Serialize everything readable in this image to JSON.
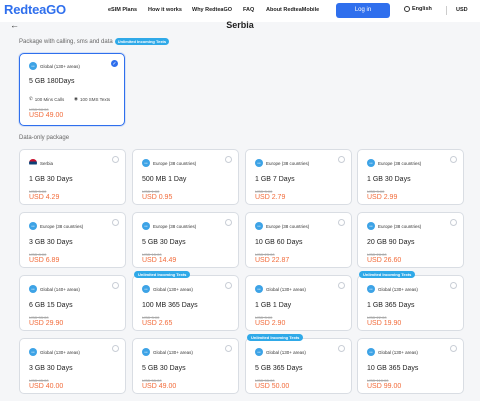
{
  "nav": {
    "logo": "RedteaGO",
    "items": [
      "eSIM Plans",
      "How it works",
      "Why RedteaGO",
      "FAQ",
      "About RedteaMobile"
    ],
    "login": "Log in",
    "language": "English",
    "currency": "USD"
  },
  "page": {
    "back": "←",
    "title": "Serbia"
  },
  "calling_section": {
    "label": "Package with calling, sms and data",
    "pill": "Unlimited Incoming Texts",
    "card": {
      "region": "Global (130+ areas)",
      "plan": "5 GB  180Days",
      "mins": "100 Mins Calls",
      "sms": "100 SMS Texts",
      "old_price": "USD 58.00",
      "price": "USD 49.00",
      "selected": true
    }
  },
  "data_section": {
    "label": "Data-only package",
    "cards": [
      {
        "region": "Serbia",
        "flag": true,
        "plan": "1 GB  30 Days",
        "old_price": "USD 5.00",
        "price": "USD 4.29"
      },
      {
        "region": "Europe (38 countries)",
        "plan": "500 MB  1 Day",
        "old_price": "USD 1.00",
        "price": "USD 0.95"
      },
      {
        "region": "Europe (38 countries)",
        "plan": "1 GB  7 Days",
        "old_price": "USD 3.00",
        "price": "USD 2.79"
      },
      {
        "region": "Europe (38 countries)",
        "plan": "1 GB  30 Days",
        "old_price": "USD 3.00",
        "price": "USD 2.99"
      },
      {
        "region": "Europe (38 countries)",
        "plan": "3 GB  30 Days",
        "old_price": "USD 8.00",
        "price": "USD 6.89"
      },
      {
        "region": "Europe (38 countries)",
        "plan": "5 GB  30 Days",
        "old_price": "USD 15.00",
        "price": "USD 14.49"
      },
      {
        "region": "Europe (38 countries)",
        "plan": "10 GB  60 Days",
        "old_price": "USD 23.00",
        "price": "USD 22.87"
      },
      {
        "region": "Europe (38 countries)",
        "plan": "20 GB  90 Days",
        "old_price": "USD 28.00",
        "price": "USD 26.60"
      },
      {
        "region": "Global (140+ areas)",
        "plan": "6 GB  15 Days",
        "old_price": "USD 33.00",
        "price": "USD 29.90"
      },
      {
        "region": "Global (130+ areas)",
        "plan": "100 MB  365 Days",
        "old_price": "USD 3.00",
        "price": "USD 2.65",
        "badge": "Unlimited Incoming Texts"
      },
      {
        "region": "Global (130+ areas)",
        "plan": "1 GB  1 Day",
        "old_price": "USD 3.00",
        "price": "USD 2.90"
      },
      {
        "region": "Global (130+ areas)",
        "plan": "1 GB  365 Days",
        "old_price": "USD 22.00",
        "price": "USD 19.90",
        "badge": "Unlimited Incoming Texts"
      },
      {
        "region": "Global (130+ areas)",
        "plan": "3 GB  30 Days",
        "old_price": "USD 45.00",
        "price": "USD 40.00"
      },
      {
        "region": "Global (130+ areas)",
        "plan": "5 GB  30 Days",
        "old_price": "USD 55.00",
        "price": "USD 49.00"
      },
      {
        "region": "Global (130+ areas)",
        "plan": "5 GB  365 Days",
        "old_price": "USD 55.00",
        "price": "USD 50.00",
        "badge": "Unlimited Incoming Texts"
      },
      {
        "region": "Global (130+ areas)",
        "plan": "10 GB  365 Days",
        "old_price": "USD 110.00",
        "price": "USD 99.00"
      }
    ]
  },
  "colors": {
    "accent": "#2f6fed",
    "price": "#f26b3a",
    "badge": "#2fa9e8"
  }
}
